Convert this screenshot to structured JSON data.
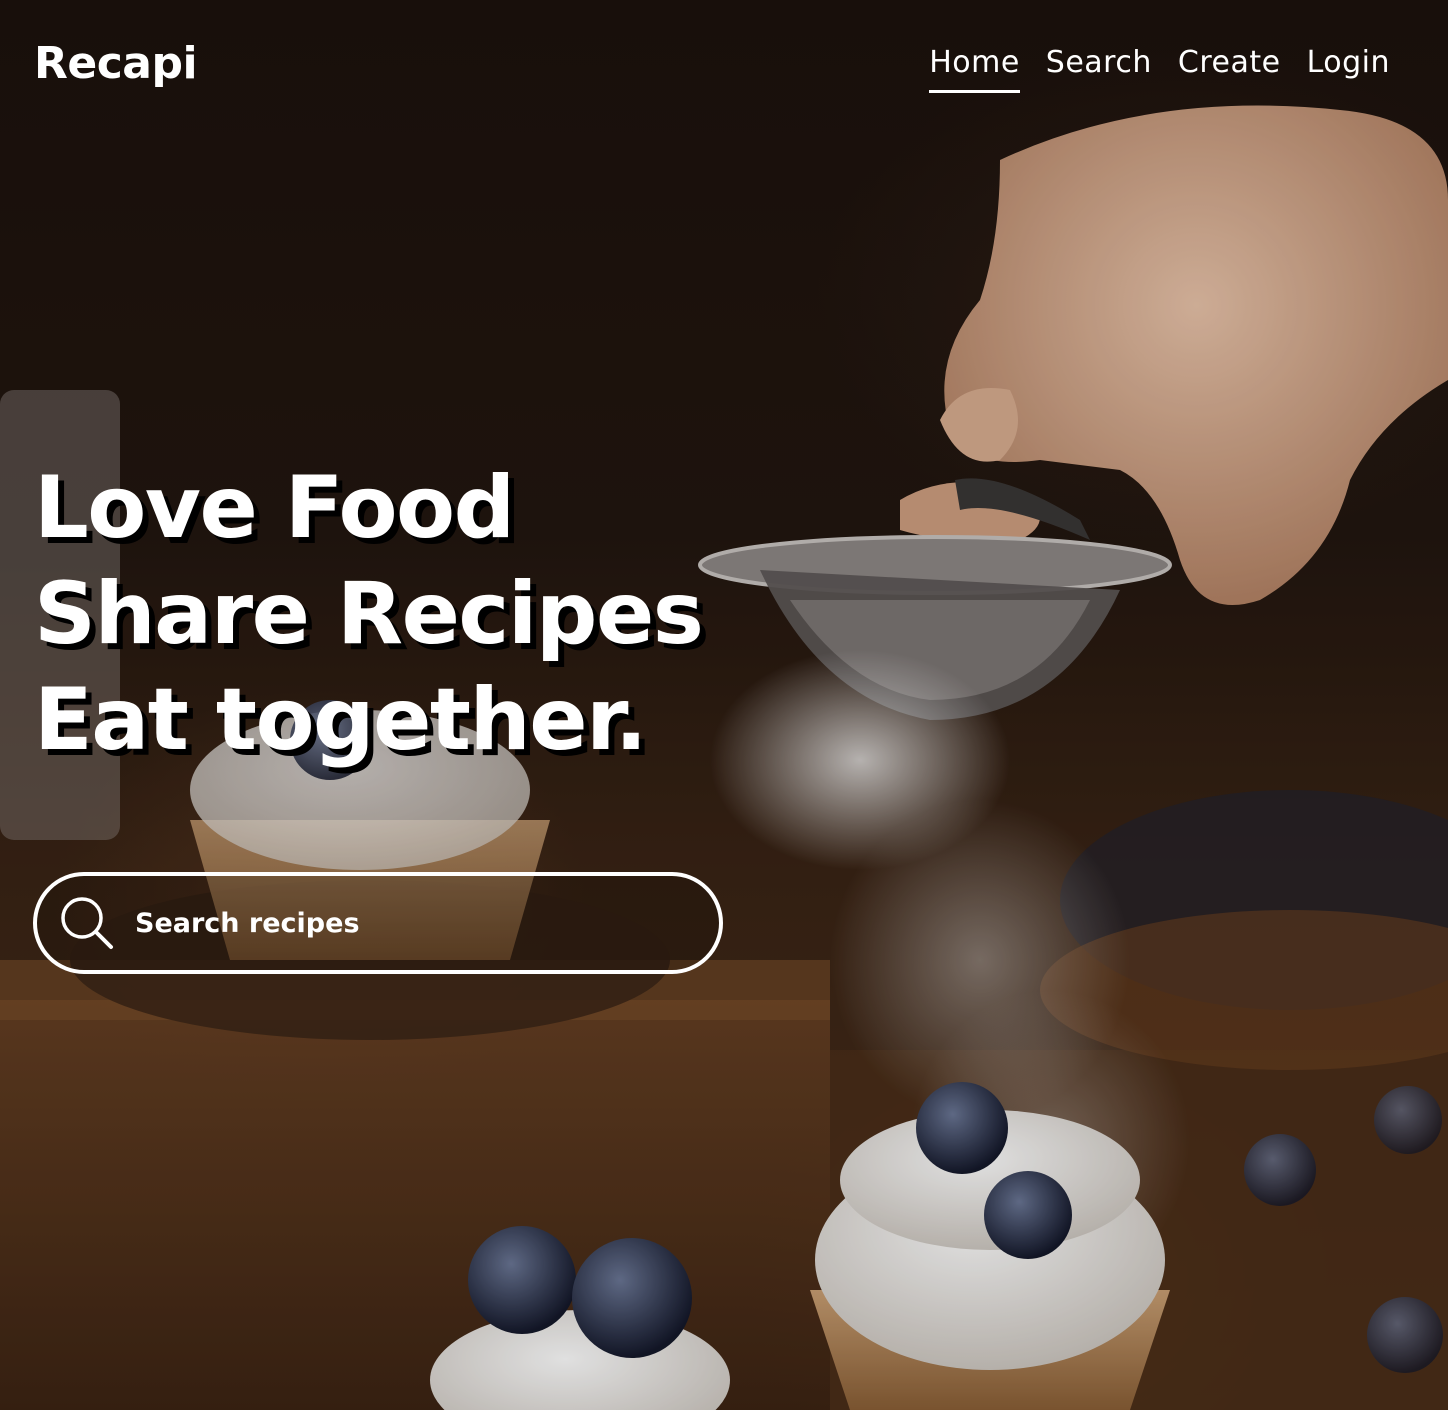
{
  "brand": {
    "logo_text": "Recapi"
  },
  "nav": {
    "items": [
      {
        "label": "Home",
        "active": true
      },
      {
        "label": "Search",
        "active": false
      },
      {
        "label": "Create",
        "active": false
      },
      {
        "label": "Login",
        "active": false
      }
    ]
  },
  "hero": {
    "lines": [
      "Love Food",
      "Share Recipes",
      "Eat together."
    ]
  },
  "search": {
    "placeholder": "Search recipes",
    "value": "",
    "icon": "search-icon"
  },
  "background": {
    "description_icon": "hero-photo",
    "accent_color": "#ffffff",
    "base_color": "#1a100b"
  }
}
